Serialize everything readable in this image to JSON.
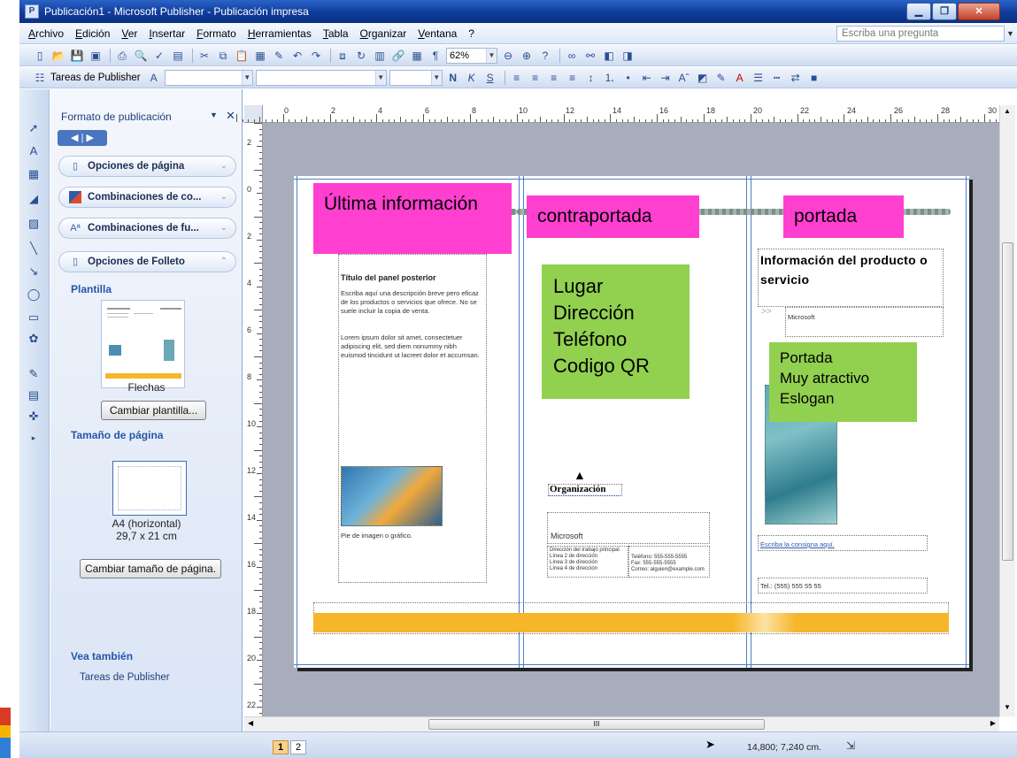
{
  "window": {
    "title": "Publicación1 - Microsoft Publisher - Publicación impresa",
    "minimize": "▁",
    "maximize": "❐",
    "close": "✕"
  },
  "menu": {
    "items": [
      "Archivo",
      "Edición",
      "Ver",
      "Insertar",
      "Formato",
      "Herramientas",
      "Tabla",
      "Organizar",
      "Ventana",
      "?"
    ],
    "ask_placeholder": "Escriba una pregunta"
  },
  "toolbar1": {
    "zoom": "62%"
  },
  "toolbar2": {
    "tasks_label": "Tareas de Publisher",
    "bold": "N",
    "italic": "K",
    "underline": "S"
  },
  "taskpane": {
    "title": "Formato de publicación",
    "sections": [
      {
        "label": "Opciones de página",
        "icon": "page-options-icon"
      },
      {
        "label": "Combinaciones de co...",
        "icon": "color-schemes-icon"
      },
      {
        "label": "Combinaciones de fu...",
        "icon": "font-schemes-icon"
      },
      {
        "label": "Opciones de Folleto",
        "icon": "brochure-options-icon"
      }
    ],
    "template_heading": "Plantilla",
    "template_name": "Flechas",
    "change_template": "Cambiar plantilla...",
    "page_size_heading": "Tamaño de página",
    "page_size_name": "A4 (horizontal)",
    "page_size_dims": "29,7 x 21 cm",
    "change_page_size": "Cambiar tamaño de página.",
    "see_also_heading": "Vea también",
    "see_also_link": "Tareas de Publisher"
  },
  "rulers": {
    "top": [
      "0",
      "2",
      "4",
      "6",
      "8",
      "10",
      "12",
      "14",
      "16",
      "18",
      "20",
      "22",
      "24",
      "26",
      "28",
      "30"
    ],
    "left": [
      "2",
      "0",
      "2",
      "4",
      "6",
      "8",
      "10",
      "12",
      "14",
      "16",
      "18",
      "20",
      "22"
    ]
  },
  "document": {
    "pink_labels": [
      "Última información",
      "contraportada",
      "portada"
    ],
    "back_panel_title": "Título del panel posterior",
    "back_panel_text1": "Escriba aquí una descripción breve pero eficaz de los productos o servicios que ofrece. No se suele incluir la copia de venta.",
    "back_panel_text2": "Lorem ipsum dolor sit amet, consectetuer adipiscing elit, sed diem nonummy nibh euismod tincidunt ut lacreet dolor et accumsan.",
    "caption": "Pie de imagen o gráfico.",
    "green_middle": [
      "Lugar",
      "Dirección",
      "Teléfono",
      "Codigo QR"
    ],
    "organization": "Organización",
    "company": "Microsoft",
    "address_lines": [
      "Dirección del trabajo principal",
      "Línea 2 de dirección",
      "Línea 3 de dirección",
      "Línea 4 de dirección"
    ],
    "phone_lines": [
      "Teléfono: 555-555-5555",
      "Fax: 555-555-5555",
      "Correo: alguien@example.com"
    ],
    "product_title": "Información del producto o servicio",
    "product_company": "Microsoft",
    "green_right": [
      "Portada",
      "Muy atractivo",
      "Eslogan"
    ],
    "slogan": "Escriba la consigna aquí.",
    "tel": "Tel.: (555) 555 55 55"
  },
  "status": {
    "pages": [
      "1",
      "2"
    ],
    "coords": "14,800; 7,240 cm.",
    "hscroll_grip": "III"
  }
}
